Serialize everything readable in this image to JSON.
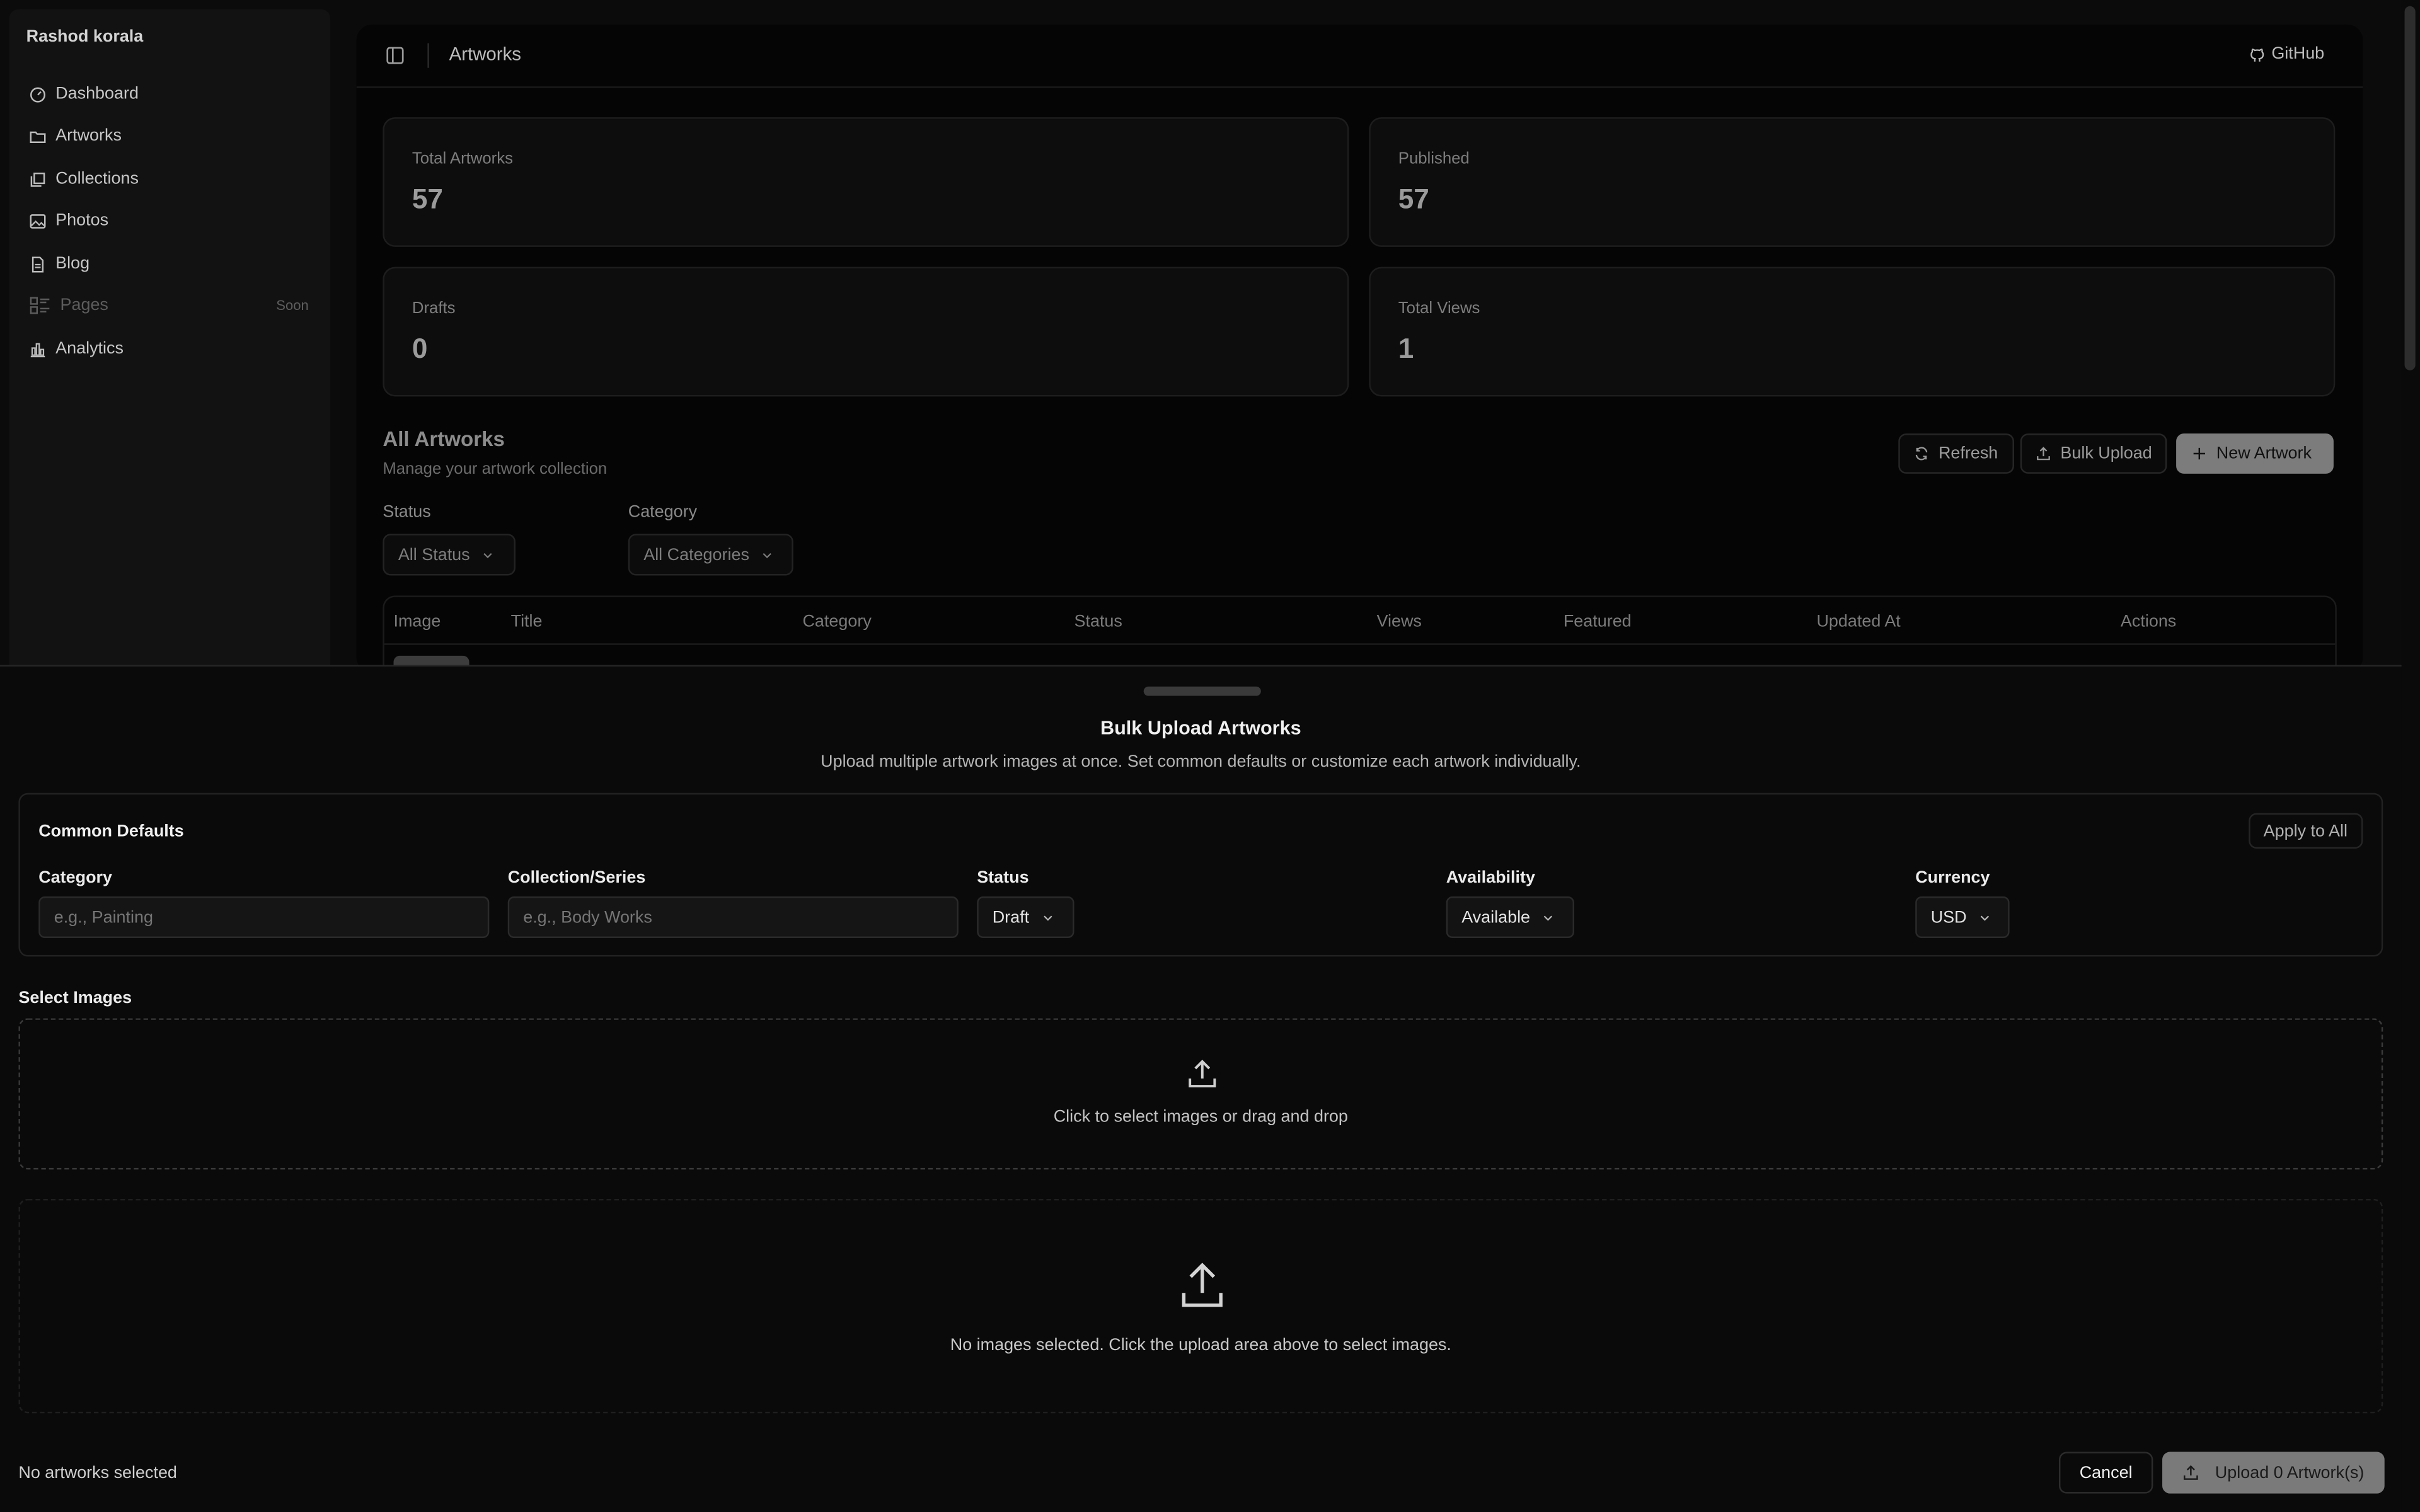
{
  "sidebar": {
    "brand": "Rashod korala",
    "items": [
      {
        "label": "Dashboard",
        "icon": "dashboard-icon"
      },
      {
        "label": "Artworks",
        "icon": "folder-icon"
      },
      {
        "label": "Collections",
        "icon": "collections-icon"
      },
      {
        "label": "Photos",
        "icon": "image-icon"
      },
      {
        "label": "Blog",
        "icon": "file-text-icon"
      },
      {
        "label": "Pages",
        "icon": "layout-list-icon",
        "badge": "Soon",
        "disabled": true
      },
      {
        "label": "Analytics",
        "icon": "bar-chart-icon"
      }
    ]
  },
  "header": {
    "title": "Artworks",
    "github_label": "GitHub"
  },
  "stats": [
    {
      "label": "Total Artworks",
      "value": "57"
    },
    {
      "label": "Published",
      "value": "57"
    },
    {
      "label": "Drafts",
      "value": "0"
    },
    {
      "label": "Total Views",
      "value": "1"
    }
  ],
  "artworks_section": {
    "title": "All Artworks",
    "subtitle": "Manage your artwork collection",
    "refresh_label": "Refresh",
    "bulk_upload_label": "Bulk Upload",
    "new_artwork_label": "New Artwork",
    "status_filter_label": "Status",
    "status_filter_value": "All Status",
    "category_filter_label": "Category",
    "category_filter_value": "All Categories",
    "table_columns": [
      "Image",
      "Title",
      "Category",
      "Status",
      "Views",
      "Featured",
      "Updated At",
      "Actions"
    ]
  },
  "bulk_upload": {
    "title": "Bulk Upload Artworks",
    "description": "Upload multiple artwork images at once. Set common defaults or customize each artwork individually.",
    "defaults": {
      "title": "Common Defaults",
      "apply_all_label": "Apply to All",
      "category_label": "Category",
      "category_placeholder": "e.g., Painting",
      "collection_label": "Collection/Series",
      "collection_placeholder": "e.g., Body Works",
      "status_label": "Status",
      "status_value": "Draft",
      "availability_label": "Availability",
      "availability_value": "Available",
      "currency_label": "Currency",
      "currency_value": "USD"
    },
    "select_images_label": "Select Images",
    "dropzone_text": "Click to select images or drag and drop",
    "empty_text": "No images selected. Click the upload area above to select images.",
    "footer_status": "No artworks selected",
    "cancel_label": "Cancel",
    "upload_label": "Upload 0 Artwork(s)"
  }
}
